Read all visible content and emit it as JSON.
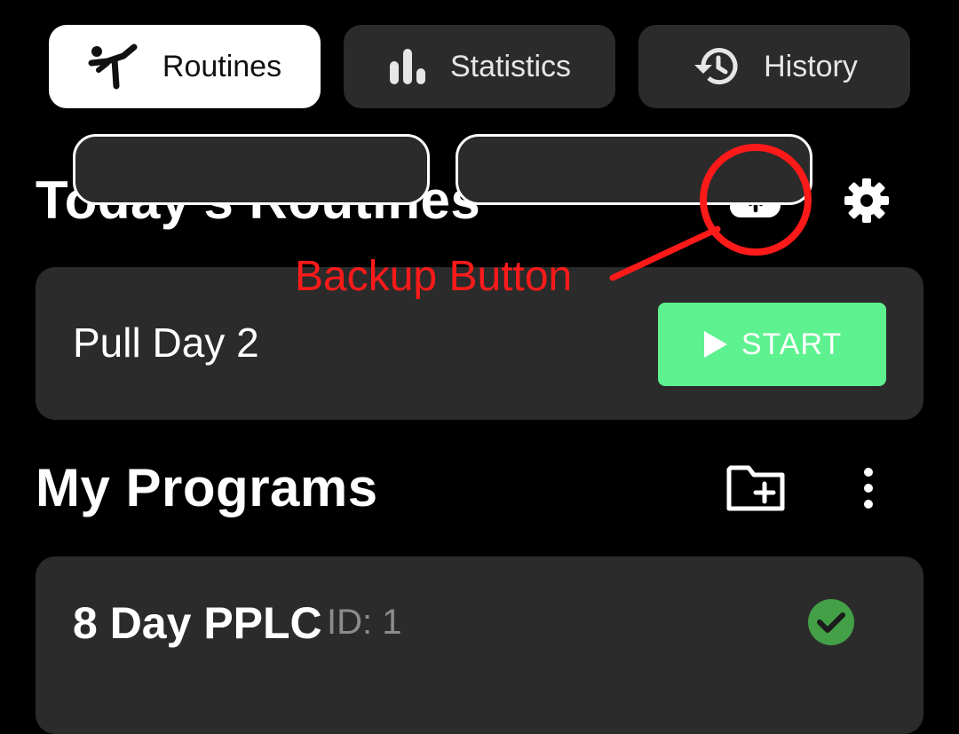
{
  "tabs": [
    {
      "label": "Routines",
      "icon": "martial-arts-kick-icon",
      "active": true
    },
    {
      "label": "Statistics",
      "icon": "bar-chart-icon",
      "active": false
    },
    {
      "label": "History",
      "icon": "history-clock-icon",
      "active": false
    }
  ],
  "today": {
    "title": "Today's Routines",
    "actions": [
      "cloud-upload-icon",
      "gear-icon"
    ],
    "routine": {
      "name": "Pull Day 2",
      "start_label": "START",
      "start_color": "#5ef18f"
    }
  },
  "programs": {
    "title": "My Programs",
    "actions": [
      "folder-add-icon",
      "more-vert-icon"
    ],
    "items": [
      {
        "name": "8 Day PPLC",
        "id_label": "ID: 1",
        "active": true,
        "check_color": "#43a047"
      }
    ]
  },
  "annotation": {
    "label": "Backup Button",
    "color": "#ff1a1a"
  }
}
